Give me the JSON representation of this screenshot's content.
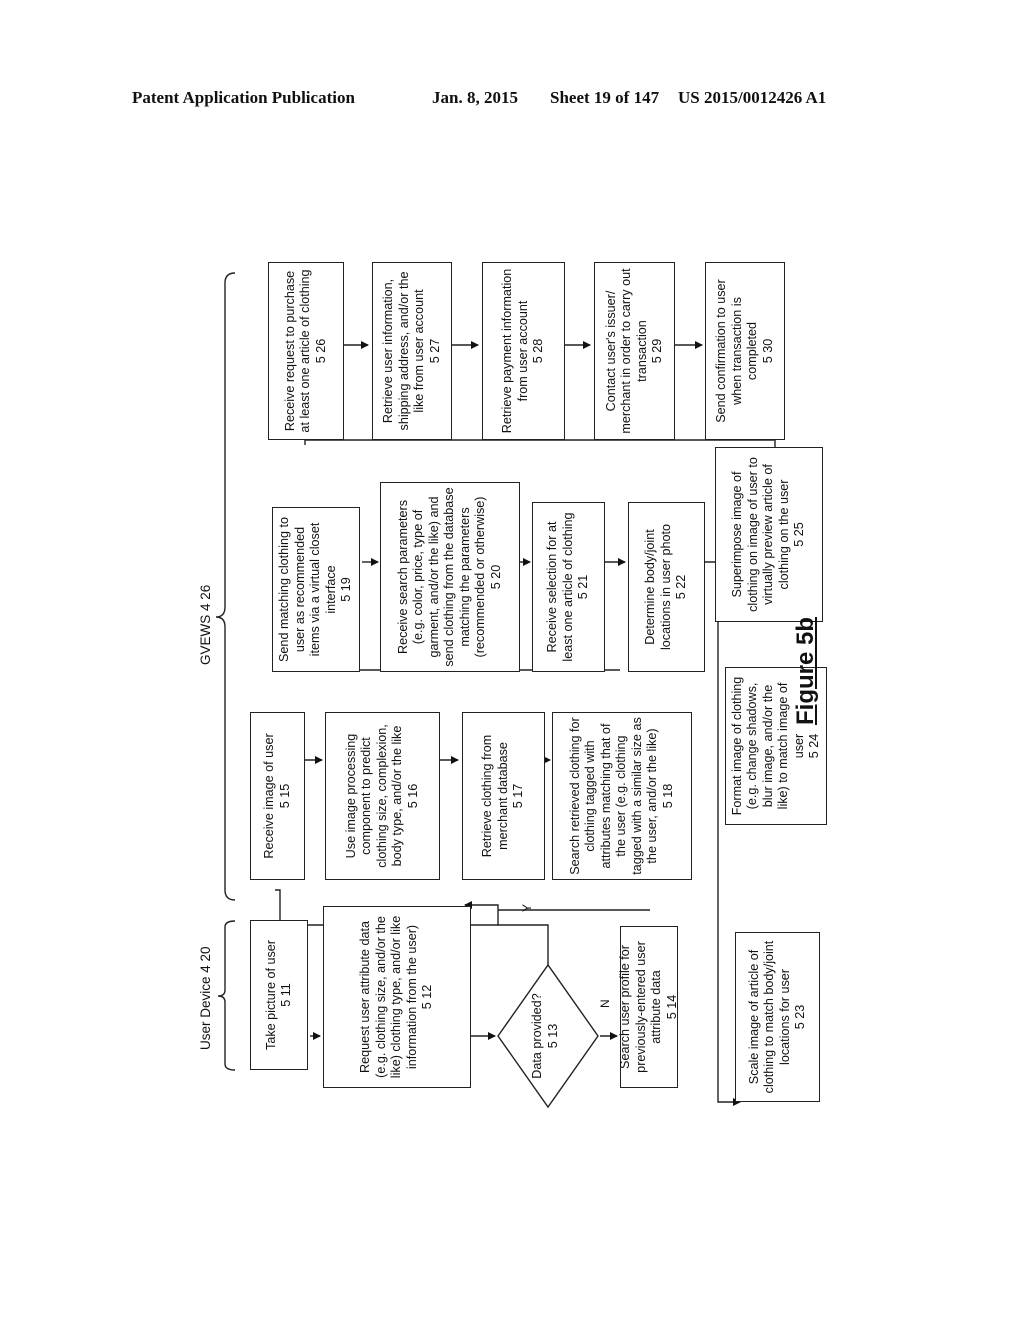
{
  "header": {
    "publication": "Patent Application Publication",
    "date": "Jan. 8, 2015",
    "sheet": "Sheet 19 of 147",
    "number": "US 2015/0012426 A1"
  },
  "groups": {
    "user_device": "User Device 4 20",
    "gvews": "GVEWS 4 26"
  },
  "figure_label": "Figure 5b",
  "decision_labels": {
    "yes": "Y",
    "no": "N"
  },
  "steps": {
    "s511": {
      "text": "Take picture of user",
      "ref": "5 11"
    },
    "s512": {
      "text": "Request user attribute data (e.g. clothing size, and/or the like) clothing type, and/or like information from the user)",
      "ref": "5 12"
    },
    "s513": {
      "text": "Data provided?",
      "ref": "5 13"
    },
    "s514": {
      "text": "Search user profile for previously-entered user attribute data",
      "ref": "5 14"
    },
    "s515": {
      "text": "Receive image of user",
      "ref": "5 15"
    },
    "s516": {
      "text": "Use image processing component to predict clothing size, complexion, body type, and/or the like",
      "ref": "5 16"
    },
    "s517": {
      "text": "Retrieve clothing from merchant database",
      "ref": "5 17"
    },
    "s518": {
      "text": "Search retrieved clothing for clothing tagged with attributes matching that of the user (e.g. clothing tagged with a similar size as the user, and/or the like)",
      "ref": "5 18"
    },
    "s519": {
      "text": "Send matching clothing to user as recommended items via a virtual closet interface",
      "ref": "5 19"
    },
    "s520": {
      "text": "Receive search parameters (e.g. color, price, type of garment, and/or the like) and send clothing from the database matching the parameters (recommended or otherwise)",
      "ref": "5 20"
    },
    "s521": {
      "text": "Receive selection for at least one article of clothing",
      "ref": "5 21"
    },
    "s522": {
      "text": "Determine body/joint locations in user photo",
      "ref": "5 22"
    },
    "s523": {
      "text": "Scale image of article of clothing to match body/joint locations for user",
      "ref": "5 23"
    },
    "s524": {
      "text": "Format image of clothing (e.g. change shadows, blur image, and/or the like) to match image of user",
      "ref": "5 24"
    },
    "s525": {
      "text": "Superimpose image of clothing on image of user to virtually preview article of clothing on the user",
      "ref": "5 25"
    },
    "s526": {
      "text": "Receive request to purchase at least one article of clothing",
      "ref": "5 26"
    },
    "s527": {
      "text": "Retrieve user information, shipping address, and/or the like from user account",
      "ref": "5 27"
    },
    "s528": {
      "text": "Retrieve payment information from user account",
      "ref": "5 28"
    },
    "s529": {
      "text": "Contact user's issuer/ merchant in order to carry out transaction",
      "ref": "5 29"
    },
    "s530": {
      "text": "Send confirmation to user when transaction is completed",
      "ref": "5 30"
    }
  }
}
